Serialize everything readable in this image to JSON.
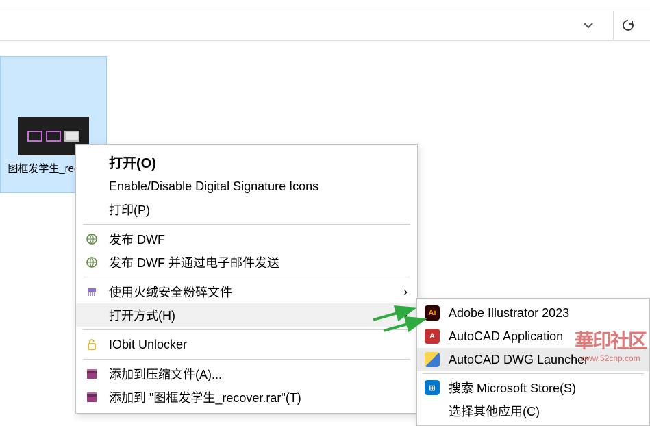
{
  "file": {
    "name": "图框发学生_recover"
  },
  "context_menu": {
    "open": "打开(O)",
    "enable_disable_sig": "Enable/Disable Digital Signature Icons",
    "print": "打印(P)",
    "publish_dwf": "发布 DWF",
    "publish_dwf_email": "发布 DWF 并通过电子邮件发送",
    "huorong_shred": "使用火绒安全粉碎文件",
    "open_with": "打开方式(H)",
    "iobit_unlocker": "IObit Unlocker",
    "add_to_archive": "添加到压缩文件(A)...",
    "add_to_named": "添加到 \"图框发学生_recover.rar\"(T)"
  },
  "submenu": {
    "ai": "Adobe Illustrator 2023",
    "acad_app": "AutoCAD Application",
    "acad_dwg": "AutoCAD DWG Launcher",
    "ms_store": "搜索 Microsoft Store(S)",
    "choose_other": "选择其他应用(C)"
  },
  "icons": {
    "ai": "Ai",
    "acad": "A",
    "ms": "⊞"
  },
  "watermark": {
    "logo": "華印社区",
    "url": "www.52cnp.com"
  }
}
